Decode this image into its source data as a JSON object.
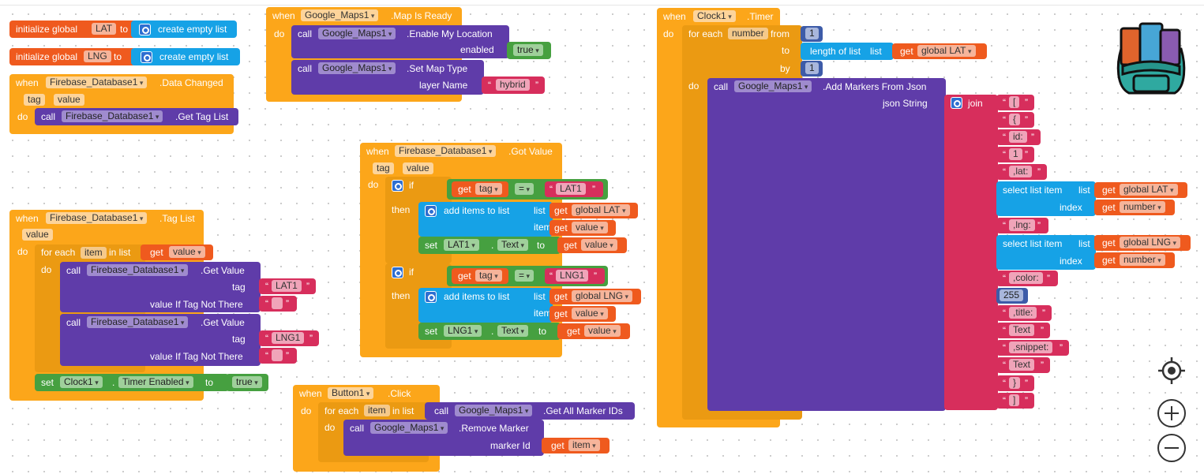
{
  "colors": {
    "event": "#fca61a",
    "procedure": "#5f3ca9",
    "variable": "#ef5a1e",
    "list": "#16a2e6",
    "math": "#3d5ba8",
    "text": "#d72e5c",
    "logic": "#46a040",
    "control": "#eb9a12"
  },
  "init_lat": {
    "initialize": "initialize global",
    "name": "LAT",
    "to": "to",
    "create_empty_list": "create empty list"
  },
  "init_lng": {
    "initialize": "initialize global",
    "name": "LNG",
    "to": "to",
    "create_empty_list": "create empty list"
  },
  "data_changed": {
    "when": "when",
    "component": "Firebase_Database1",
    "event": ".Data Changed",
    "param_tag": "tag",
    "param_value": "value",
    "do": "do",
    "call": "call",
    "call_component": "Firebase_Database1",
    "method": ".Get Tag List"
  },
  "tag_list": {
    "when": "when",
    "component": "Firebase_Database1",
    "event": ".Tag List",
    "param_value": "value",
    "do": "do",
    "for_each": "for each",
    "item_var": "item",
    "in_list": "in list",
    "get": "get",
    "get_value": "value",
    "do2": "do",
    "call1": "call",
    "call1_component": "Firebase_Database1",
    "call1_method": ".Get Value",
    "tag_label": "tag",
    "tag1": "LAT1",
    "value_if_label": "value If Tag Not There",
    "empty1": " ",
    "call2": "call",
    "call2_component": "Firebase_Database1",
    "call2_method": ".Get Value",
    "tag_label2": "tag",
    "tag2": "LNG1",
    "value_if_label2": "value If Tag Not There",
    "empty2": " ",
    "set": "set",
    "clock": "Clock1",
    "dot": ".",
    "prop": "Timer Enabled",
    "to": "to",
    "true": "true"
  },
  "map_ready": {
    "when": "when",
    "component": "Google_Maps1",
    "event": ".Map Is Ready",
    "do": "do",
    "call1": "call",
    "call1_component": "Google_Maps1",
    "call1_method": ".Enable My Location",
    "enabled_label": "enabled",
    "enabled_value": "true",
    "call2": "call",
    "call2_component": "Google_Maps1",
    "call2_method": ".Set Map Type",
    "layer_label": "layer Name",
    "layer_value": "hybrid"
  },
  "got_value": {
    "when": "when",
    "component": "Firebase_Database1",
    "event": ".Got Value",
    "param_tag": "tag",
    "param_value": "value",
    "do": "do",
    "if1": "if",
    "get1": "get",
    "get1_var": "tag",
    "eq1": "=",
    "lat1": "LAT1",
    "then1": "then",
    "add1": "add items to list",
    "list_label1": "list",
    "get_list1": "get",
    "list_var1": "global LAT",
    "item_label1": "item",
    "get_item1": "get",
    "item_var1": "value",
    "set1": "set",
    "set1_comp": "LAT1",
    "dot1": ".",
    "set1_prop": "Text",
    "to1": "to",
    "get_set1": "get",
    "set1_var": "value",
    "if2": "if",
    "get2": "get",
    "get2_var": "tag",
    "eq2": "=",
    "lng1": "LNG1",
    "then2": "then",
    "add2": "add items to list",
    "list_label2": "list",
    "get_list2": "get",
    "list_var2": "global LNG",
    "item_label2": "item",
    "get_item2": "get",
    "item_var2": "value",
    "set2": "set",
    "set2_comp": "LNG1",
    "dot2": ".",
    "set2_prop": "Text",
    "to2": "to",
    "get_set2": "get",
    "set2_var": "value"
  },
  "button_click": {
    "when": "when",
    "component": "Button1",
    "event": ".Click",
    "do": "do",
    "for_each": "for each",
    "item_var": "item",
    "in_list": "in list",
    "call1": "call",
    "call1_component": "Google_Maps1",
    "call1_method": ".Get All Marker IDs",
    "do2": "do",
    "call2": "call",
    "call2_component": "Google_Maps1",
    "call2_method": ".Remove Marker",
    "marker_label": "marker Id",
    "get": "get",
    "get_var": "item"
  },
  "clock_timer": {
    "when": "when",
    "component": "Clock1",
    "event": ".Timer",
    "do": "do",
    "for_each": "for each",
    "number_var": "number",
    "from": "from",
    "from_val": "1",
    "to": "to",
    "length_of_list": "length of list",
    "list_label": "list",
    "get": "get",
    "get_var": "global LAT",
    "by": "by",
    "by_val": "1",
    "do2": "do",
    "call": "call",
    "call_component": "Google_Maps1",
    "call_method": ".Add Markers From Json",
    "json_label": "json String",
    "join": "join",
    "j1": "[",
    "j2": "{",
    "j3": "id:",
    "j4": "1",
    "j5": ",lat:",
    "sel1": "select list item",
    "sel1_list": "list",
    "sel1_get": "get",
    "sel1_var": "global LAT",
    "sel1_index": "index",
    "sel1_iget": "get",
    "sel1_ivar": "number",
    "j6": ",lng:",
    "sel2": "select list item",
    "sel2_list": "list",
    "sel2_get": "get",
    "sel2_var": "global LNG",
    "sel2_index": "index",
    "sel2_iget": "get",
    "sel2_ivar": "number",
    "j7": ",color:",
    "j8": "255",
    "j9": ",title:",
    "j10": "Text",
    "j11": ",snippet:",
    "j12": "Text",
    "j13": "}",
    "j14": "]"
  }
}
